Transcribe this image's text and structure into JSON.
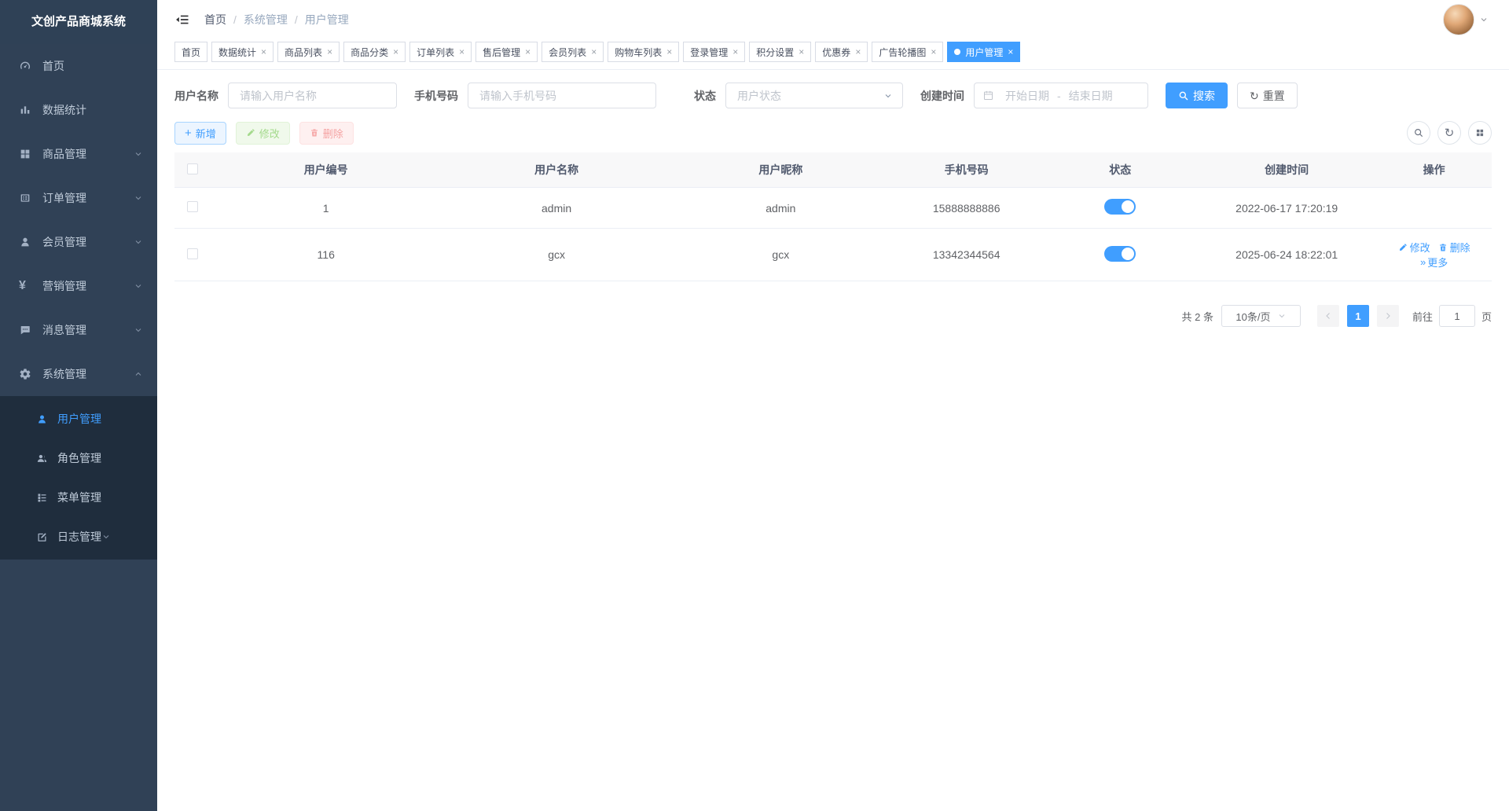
{
  "app": {
    "title": "文创产品商城系统"
  },
  "colors": {
    "primary": "#409eff",
    "sidebar_bg": "#304156",
    "submenu_bg": "#1f2d3d",
    "active_tab_bg": "#409eff",
    "toggle_on": "#409eff"
  },
  "glyphs": {
    "close": "×",
    "slash": "/",
    "more": "»",
    "yen": "¥",
    "plus": "+",
    "refresh": "↻",
    "dash": "-"
  },
  "sidebar": {
    "items": [
      {
        "label": "首页"
      },
      {
        "label": "数据统计"
      },
      {
        "label": "商品管理"
      },
      {
        "label": "订单管理"
      },
      {
        "label": "会员管理"
      },
      {
        "label": "营销管理"
      },
      {
        "label": "消息管理"
      },
      {
        "label": "系统管理"
      }
    ],
    "submenu": [
      {
        "label": "用户管理"
      },
      {
        "label": "角色管理"
      },
      {
        "label": "菜单管理"
      },
      {
        "label": "日志管理"
      }
    ]
  },
  "nav": {
    "breadcrumb": [
      "首页",
      "系统管理",
      "用户管理"
    ]
  },
  "tabs": [
    {
      "label": "首页"
    },
    {
      "label": "数据统计"
    },
    {
      "label": "商品列表"
    },
    {
      "label": "商品分类"
    },
    {
      "label": "订单列表"
    },
    {
      "label": "售后管理"
    },
    {
      "label": "会员列表"
    },
    {
      "label": "购物车列表"
    },
    {
      "label": "登录管理"
    },
    {
      "label": "积分设置"
    },
    {
      "label": "优惠券"
    },
    {
      "label": "广告轮播图"
    },
    {
      "label": "用户管理"
    }
  ],
  "search": {
    "username_label": "用户名称",
    "username_placeholder": "请输入用户名称",
    "phone_label": "手机号码",
    "phone_placeholder": "请输入手机号码",
    "status_label": "状态",
    "status_placeholder": "用户状态",
    "created_label": "创建时间",
    "date_start": "开始日期",
    "date_end": "结束日期",
    "search_button": "搜索",
    "reset_button": "重置"
  },
  "actions": {
    "add": "新增",
    "edit": "修改",
    "del": "删除"
  },
  "table": {
    "headers": [
      "用户编号",
      "用户名称",
      "用户昵称",
      "手机号码",
      "状态",
      "创建时间",
      "操作"
    ],
    "rows": [
      {
        "id": "1",
        "name": "admin",
        "nick": "admin",
        "phone": "15888888886",
        "created": "2022-06-17 17:20:19"
      },
      {
        "id": "116",
        "name": "gcx",
        "nick": "gcx",
        "phone": "13342344564",
        "created": "2025-06-24 18:22:01"
      }
    ]
  },
  "row_actions": [
    "修改",
    "删除",
    "更多"
  ],
  "pagination": {
    "total": "共 2 条",
    "size": "10条/页",
    "page": "1",
    "goto_label": "前往",
    "goto_value": "1",
    "unit": "页"
  }
}
